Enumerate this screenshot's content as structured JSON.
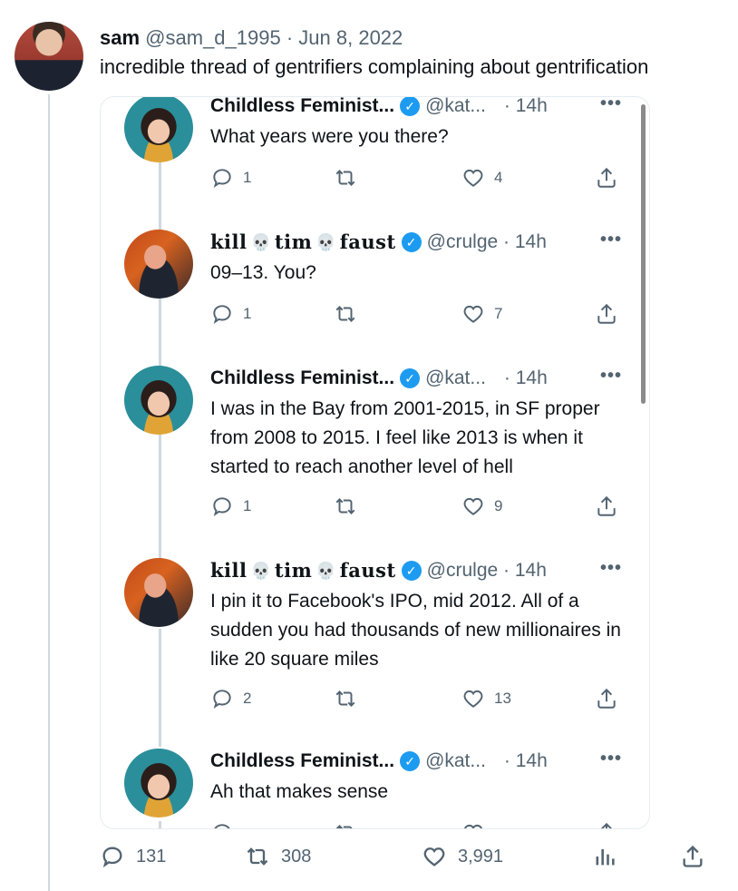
{
  "tweet": {
    "name": "sam",
    "handle": "@sam_d_1995",
    "separator": "·",
    "date": "Jun 8, 2022",
    "text": "incredible thread of gentrifiers complaining about gentrification",
    "stats": {
      "replies": "131",
      "retweets": "308",
      "likes": "3,991"
    }
  },
  "quote": {
    "replies": [
      {
        "name": "Childless Feminist...",
        "handle": "@kat...",
        "time": "· 14h",
        "text": "What years were you there?",
        "reply_count": "1",
        "like_count": "4"
      },
      {
        "name_parts": [
          "kill",
          "tim",
          "faust"
        ],
        "handle": "@crulge · 14h",
        "text": "09–13. You?",
        "reply_count": "1",
        "like_count": "7"
      },
      {
        "name": "Childless Feminist...",
        "handle": "@kat...",
        "time": "· 14h",
        "text": "I was in the Bay from 2001-2015, in SF proper from 2008 to 2015. I feel like 2013 is when it started to reach another level of hell",
        "reply_count": "1",
        "like_count": "9"
      },
      {
        "name_parts": [
          "kill",
          "tim",
          "faust"
        ],
        "handle": "@crulge · 14h",
        "text": "I pin it to Facebook's IPO, mid 2012. All of a sudden you had thousands of new millionaires in like 20 square miles",
        "reply_count": "2",
        "like_count": "13"
      },
      {
        "name": "Childless Feminist...",
        "handle": "@kat...",
        "time": "· 14h",
        "text": "Ah that makes sense"
      }
    ],
    "more_glyph": "•••",
    "skull_glyph": "💀",
    "verified_glyph": "✓"
  },
  "icons": [
    "reply-icon",
    "retweet-icon",
    "like-icon",
    "share-icon",
    "views-icon",
    "verified-icon",
    "more-icon",
    "skull-icon"
  ],
  "colors": {
    "verified": "#1d9bf0",
    "muted": "#536471",
    "line": "#cfd9de"
  }
}
